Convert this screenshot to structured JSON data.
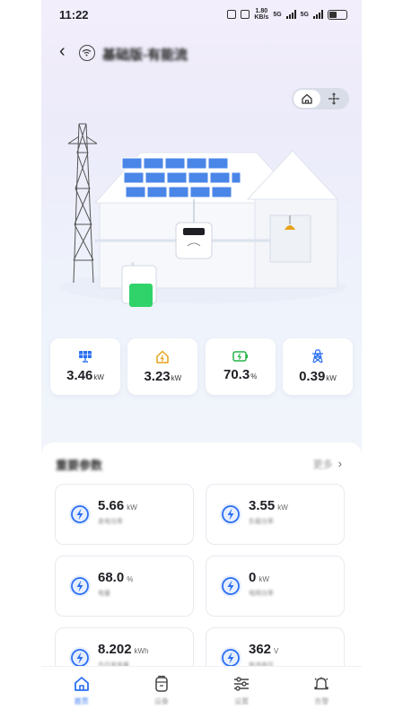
{
  "status_bar": {
    "time": "11:22",
    "net_speed_value": "1.80",
    "net_speed_unit": "KB/s",
    "sim1": "5G",
    "sim2": "5G"
  },
  "header": {
    "title": "基础版-有能流"
  },
  "view_toggle": {
    "active": "home",
    "options": [
      "home-icon",
      "flow-icon"
    ]
  },
  "summary": [
    {
      "icon": "solar-panel-icon",
      "value": "3.46",
      "unit": "kW",
      "color": "#2a6ff2"
    },
    {
      "icon": "home-load-icon",
      "value": "3.23",
      "unit": "kW",
      "color": "#e7a31a"
    },
    {
      "icon": "battery-icon",
      "value": "70.3",
      "unit": "%",
      "color": "#27b34a"
    },
    {
      "icon": "grid-tower-icon",
      "value": "0.39",
      "unit": "kW",
      "color": "#2a6ff2"
    }
  ],
  "params": {
    "title": "重要参数",
    "more_label": "更多",
    "items": [
      {
        "value": "5.66",
        "unit": "kW",
        "label": "发电功率"
      },
      {
        "value": "3.55",
        "unit": "kW",
        "label": "负载功率"
      },
      {
        "value": "68.0",
        "unit": "%",
        "label": "电量"
      },
      {
        "value": "0",
        "unit": "kW",
        "label": "电网功率"
      },
      {
        "value": "8.202",
        "unit": "kWh",
        "label": "今日发电量"
      },
      {
        "value": "362",
        "unit": "V",
        "label": "电池电压"
      }
    ]
  },
  "nav": {
    "items": [
      {
        "label": "首页",
        "icon": "home-icon",
        "active": true
      },
      {
        "label": "设备",
        "icon": "battery-device-icon",
        "active": false
      },
      {
        "label": "设置",
        "icon": "sliders-icon",
        "active": false
      },
      {
        "label": "告警",
        "icon": "bell-icon",
        "active": false
      }
    ]
  },
  "colors": {
    "accent": "#2a6ff2",
    "battery_green": "#27b34a",
    "load_orange": "#e7a31a"
  }
}
